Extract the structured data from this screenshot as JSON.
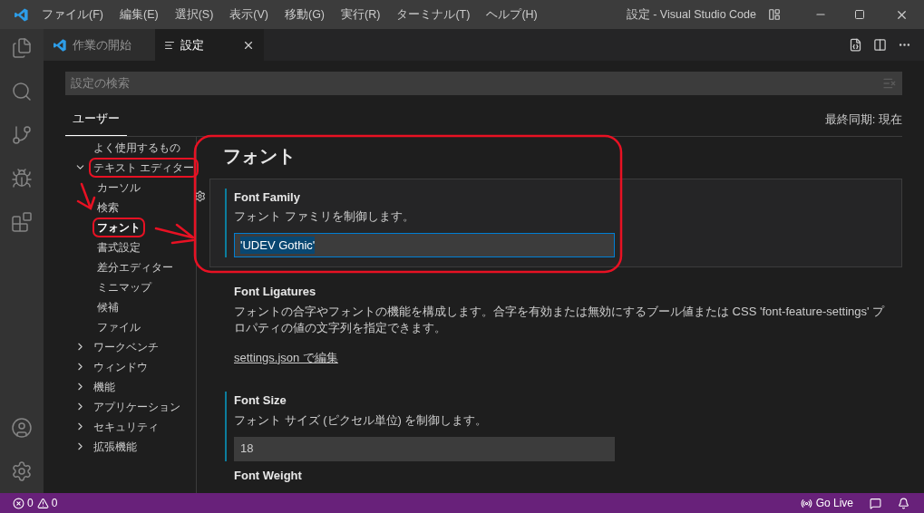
{
  "window": {
    "title": "設定 - Visual Studio Code"
  },
  "menu": [
    "ファイル(F)",
    "編集(E)",
    "選択(S)",
    "表示(V)",
    "移動(G)",
    "実行(R)",
    "ターミナル(T)",
    "ヘルプ(H)"
  ],
  "tabs": [
    {
      "label": "作業の開始",
      "selected": false,
      "kind": "welcome"
    },
    {
      "label": "設定",
      "selected": true,
      "kind": "settings"
    }
  ],
  "search": {
    "placeholder": "設定の検索"
  },
  "scope_tabs": [
    {
      "label": "ユーザー",
      "selected": true
    }
  ],
  "sync_status": "最終同期: 現在",
  "toc": [
    {
      "label": "よく使用するもの",
      "kind": "leaf",
      "selected": false,
      "circled": false
    },
    {
      "label": "テキスト エディター",
      "kind": "group",
      "expanded": true,
      "selected": false,
      "circled": true,
      "children": [
        {
          "label": "カーソル",
          "selected": false,
          "circled": false
        },
        {
          "label": "検索",
          "selected": false,
          "circled": false
        },
        {
          "label": "フォント",
          "selected": true,
          "circled": true
        },
        {
          "label": "書式設定",
          "selected": false,
          "circled": false
        },
        {
          "label": "差分エディター",
          "selected": false,
          "circled": false
        },
        {
          "label": "ミニマップ",
          "selected": false,
          "circled": false
        },
        {
          "label": "候補",
          "selected": false,
          "circled": false
        },
        {
          "label": "ファイル",
          "selected": false,
          "circled": false
        }
      ]
    },
    {
      "label": "ワークベンチ",
      "kind": "group",
      "expanded": false,
      "selected": false,
      "circled": false
    },
    {
      "label": "ウィンドウ",
      "kind": "group",
      "expanded": false,
      "selected": false,
      "circled": false
    },
    {
      "label": "機能",
      "kind": "group",
      "expanded": false,
      "selected": false,
      "circled": false
    },
    {
      "label": "アプリケーション",
      "kind": "group",
      "expanded": false,
      "selected": false,
      "circled": false
    },
    {
      "label": "セキュリティ",
      "kind": "group",
      "expanded": false,
      "selected": false,
      "circled": false
    },
    {
      "label": "拡張機能",
      "kind": "group",
      "expanded": false,
      "selected": false,
      "circled": false
    }
  ],
  "section_title": "フォント",
  "settings": [
    {
      "title": "Font Family",
      "description": "フォント ファミリを制御します。",
      "kind": "text",
      "value": "'UDEV Gothic'",
      "value_selected": true,
      "focused": true,
      "modified": true
    },
    {
      "title": "Font Ligatures",
      "description": "フォントの合字やフォントの機能を構成します。合字を有効または無効にするブール値または CSS 'font-feature-settings' プロパティの値の文字列を指定できます。",
      "kind": "link",
      "link": "settings.json で編集",
      "focused": false,
      "modified": false
    },
    {
      "title": "Font Size",
      "description": "フォント サイズ (ピクセル単位) を制御します。",
      "kind": "text",
      "value": "18",
      "value_selected": false,
      "focused": false,
      "modified": true
    },
    {
      "title": "Font Weight",
      "kind": "title_only",
      "focused": false,
      "modified": false
    }
  ],
  "status_bar": {
    "errors": "0",
    "warnings": "0",
    "go_live": "Go Live"
  }
}
